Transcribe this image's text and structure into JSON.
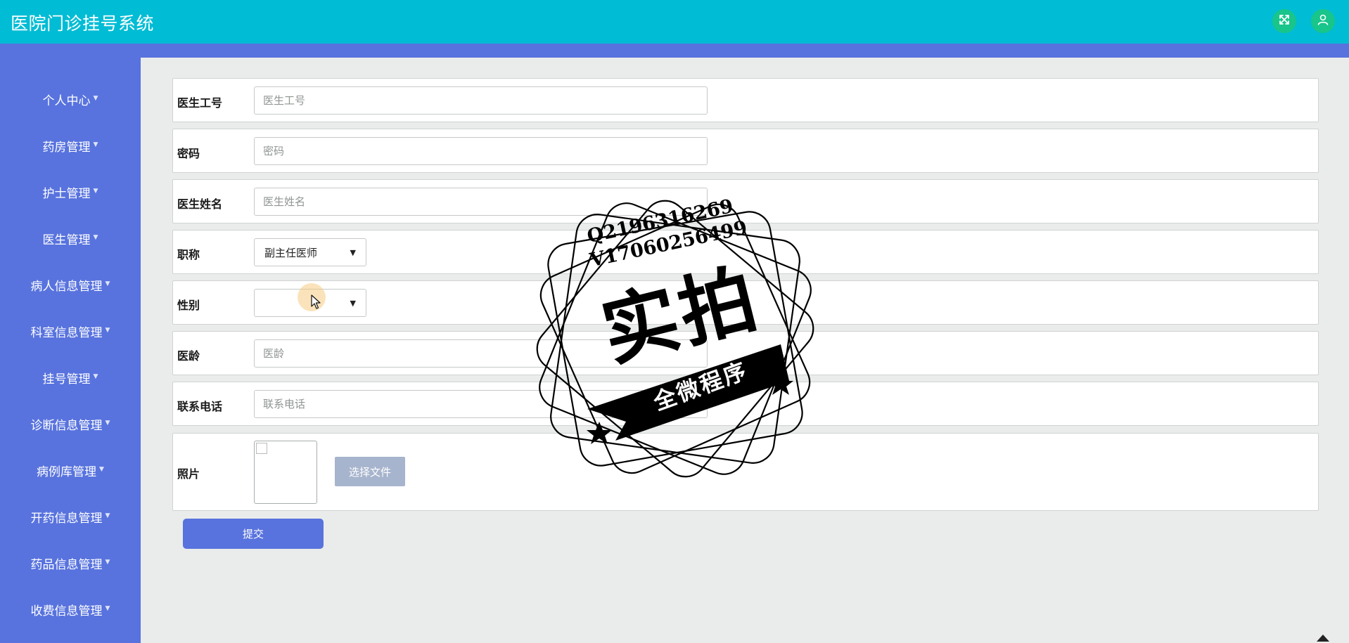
{
  "app": {
    "title": "医院门诊挂号系统"
  },
  "topbar": {
    "fullscreen_icon": "fullscreen-icon",
    "user_icon": "user-icon",
    "button_color": "#18c58a",
    "bar_color": "#00bcd4"
  },
  "sidebar": {
    "color": "#5873de",
    "items": [
      {
        "label": "个人中心"
      },
      {
        "label": "药房管理"
      },
      {
        "label": "护士管理"
      },
      {
        "label": "医生管理"
      },
      {
        "label": "病人信息管理"
      },
      {
        "label": "科室信息管理"
      },
      {
        "label": "挂号管理"
      },
      {
        "label": "诊断信息管理"
      },
      {
        "label": "病例库管理"
      },
      {
        "label": "开药信息管理"
      },
      {
        "label": "药品信息管理"
      },
      {
        "label": "收费信息管理"
      }
    ]
  },
  "form": {
    "fields": [
      {
        "label": "医生工号",
        "placeholder": "医生工号",
        "value": ""
      },
      {
        "label": "密码",
        "placeholder": "密码",
        "value": ""
      },
      {
        "label": "医生姓名",
        "placeholder": "医生姓名",
        "value": ""
      },
      {
        "label": "职称",
        "selected": "副主任医师"
      },
      {
        "label": "性别",
        "selected": ""
      },
      {
        "label": "医龄",
        "placeholder": "医龄",
        "value": ""
      },
      {
        "label": "联系电话",
        "placeholder": "联系电话",
        "value": ""
      },
      {
        "label": "照片",
        "file_button": "选择文件"
      }
    ],
    "submit_label": "提交"
  },
  "watermark": {
    "line1": "Q2196316269",
    "line2": "V17060256499",
    "big": "实拍",
    "small": "全微程序"
  }
}
